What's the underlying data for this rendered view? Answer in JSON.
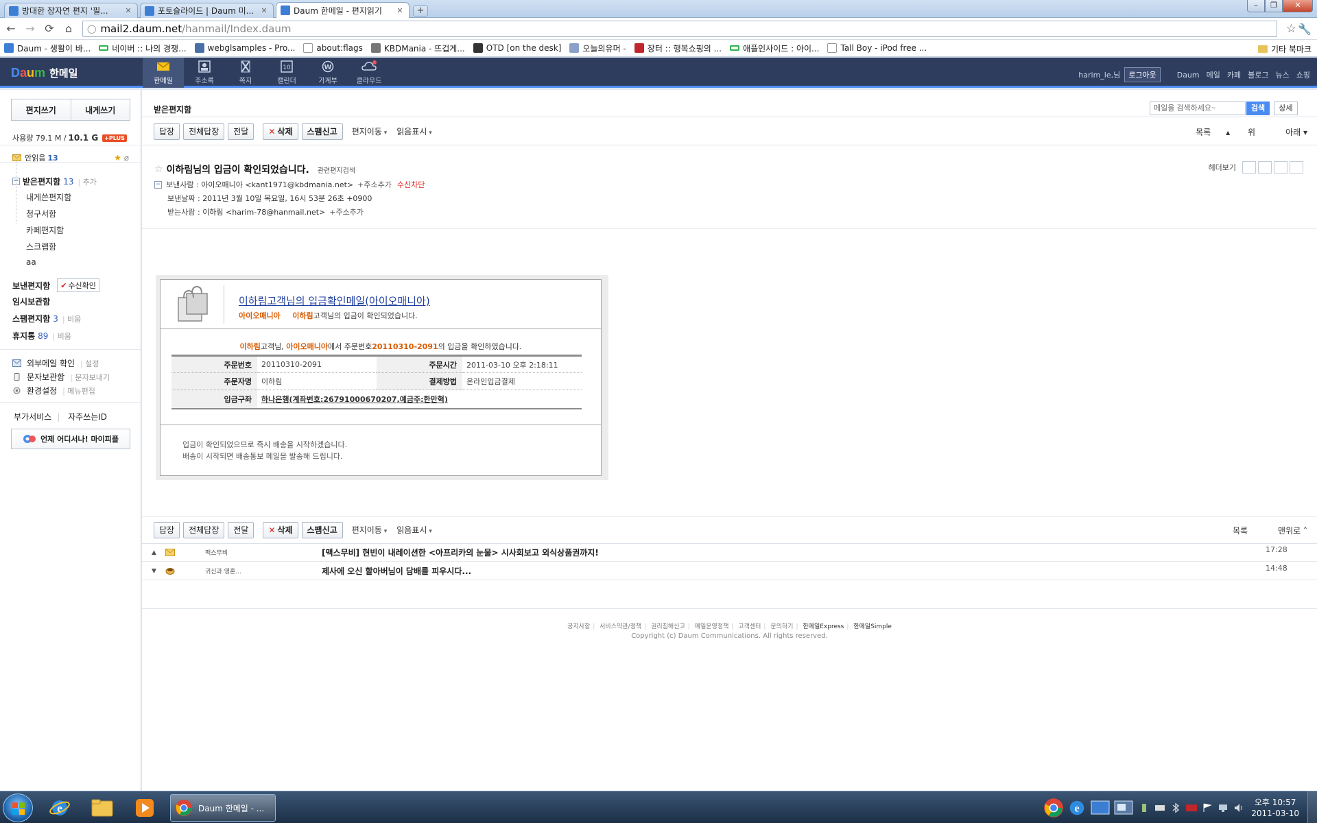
{
  "browser": {
    "tabs": [
      {
        "title": "방대한 장자연 편지 '필...",
        "active": false
      },
      {
        "title": "포토슬라이드 | Daum 미...",
        "active": false
      },
      {
        "title": "Daum 한메일 - 편지읽기",
        "active": true
      }
    ],
    "url_host": "mail2.daum.net",
    "url_path": "/hanmail/Index.daum",
    "bookmarks": [
      "Daum - 생활이 바...",
      "네이버 :: 나의 경쟁...",
      "webglsamples - Pro...",
      "about:flags",
      "KBDMania - 뜨겁게...",
      "OTD [on the desk]",
      "오늘의유머 -",
      "장터 :: 행복쇼핑의 ...",
      "애플인사이드 : 아이...",
      "Tall Boy - iPod free ..."
    ],
    "other_bookmarks": "기타 북마크"
  },
  "header": {
    "logo_service": "한메일",
    "nav": [
      {
        "label": "한메일",
        "icon": "mail-icon",
        "active": true
      },
      {
        "label": "주소록",
        "icon": "addressbook-icon",
        "active": false
      },
      {
        "label": "쪽지",
        "icon": "note-icon",
        "active": false
      },
      {
        "label": "캘린더",
        "icon": "calendar-icon",
        "active": false
      },
      {
        "label": "가계부",
        "icon": "wallet-icon",
        "active": false
      },
      {
        "label": "클라우드",
        "icon": "cloud-icon",
        "active": false
      }
    ],
    "user": "harim_le,님",
    "logout": "로그아웃",
    "links": [
      "Daum",
      "메일",
      "카페",
      "블로그",
      "뉴스",
      "쇼핑"
    ]
  },
  "sidebar": {
    "compose": "편지쓰기",
    "self_compose": "내게쓰기",
    "usage_label": "사용량 79.1 M",
    "usage_total": "10.1 G",
    "plus": "+PLUS",
    "unread_label": "안읽음",
    "unread_count": "13",
    "inbox": {
      "label": "받은편지함",
      "count": "13",
      "action": "추가"
    },
    "subfolders": [
      "내게쓴편지함",
      "청구서함",
      "카페편지함",
      "스크랩함",
      "aa"
    ],
    "sent": {
      "label": "보낸편지함",
      "action": "수신확인"
    },
    "temp": {
      "label": "임시보관함"
    },
    "spam": {
      "label": "스팸편지함",
      "count": "3",
      "action": "비움"
    },
    "trash": {
      "label": "휴지통",
      "count": "89",
      "action": "비움"
    },
    "tools": [
      {
        "label": "외부메일 확인",
        "action": "설정"
      },
      {
        "label": "문자보관함",
        "action": "문자보내기"
      },
      {
        "label": "환경설정",
        "action": "메뉴편집"
      }
    ],
    "services": [
      "부가서비스",
      "자주쓰는ID"
    ],
    "mypeople": "언제 어디서나! 마이피플"
  },
  "main": {
    "folder_title": "받은편지함",
    "search_placeholder": "메일을 검색하세요~",
    "search_button": "검색",
    "detail_button": "상세",
    "actions": {
      "reply": "답장",
      "reply_all": "전체답장",
      "forward": "전달",
      "delete": "삭제",
      "spam": "스팸신고",
      "move": "편지이동",
      "read_mark": "읽음표시",
      "list": "목록",
      "up": "위",
      "down": "아래",
      "top": "맨위로"
    },
    "message": {
      "subject": "이하림님의 입금이 확인되었습니다.",
      "related": "관련편지검색",
      "sender_label": "보낸사람 :",
      "sender": "아이오매니아 <kant1971@kbdmania.net>",
      "add_contact": "+주소추가",
      "block": "수신차단",
      "date_label": "보낸날짜 :",
      "date": "2011년 3월 10일 목요일, 16시 53분 26초 +0900",
      "to_label": "받는사람 :",
      "to": "이하림 <harim-78@hanmail.net>",
      "header_view": "헤더보기"
    },
    "body": {
      "heading": "이하림고객님의 입금확인메일(아이오매니아)",
      "shop": "아이오매니아",
      "customer": "이하림",
      "subline_rest": "고객님의 입금이 확인되었습니다.",
      "msg_name": "이하림",
      "msg_p1": "고객님,",
      "msg_shop": "아이오매니아",
      "msg_p2": "에서 주문번호",
      "msg_order": "20110310-2091",
      "msg_p3": "의 입금을 확인하였습니다.",
      "order_no_label": "주문번호",
      "order_no": "20110310-2091",
      "order_time_label": "주문시간",
      "order_time": "2011-03-10 오후 2:18:11",
      "orderer_label": "주문자명",
      "orderer": "이하림",
      "payment_label": "결제방법",
      "payment": "온라인입금결제",
      "account_label": "입금구좌",
      "account": "하나은행(계좌번호:26791000670207,예금주:한만혁)",
      "footer1": "입금이 확인되었으므로 즉시 배송을 시작하겠습니다.",
      "footer2": "배송이 시작되면 배송통보 메일을 발송해 드립니다."
    },
    "prev_next": [
      {
        "dir": "▲",
        "from": "맥스무비",
        "subject": "[맥스무비] 현빈이 내레이션한 <아프리카의 눈물> 시사회보고 외식상품권까지!",
        "time": "17:28"
      },
      {
        "dir": "▼",
        "from": "귀신과 영혼...",
        "subject": "제사에 오신 할아버님이 담배를 피우시다...",
        "time": "14:48"
      }
    ],
    "footer_links": [
      "공지사항",
      "서비스약관/정책",
      "권리침해신고",
      "메일운영정책",
      "고객센터",
      "문의하기",
      "한메일Express",
      "한메일Simple"
    ],
    "copyright": "Copyright (c) Daum Communications. All rights reserved."
  },
  "taskbar": {
    "app_label": "Daum 한메일 - ...",
    "time": "오후 10:57",
    "date": "2011-03-10"
  }
}
